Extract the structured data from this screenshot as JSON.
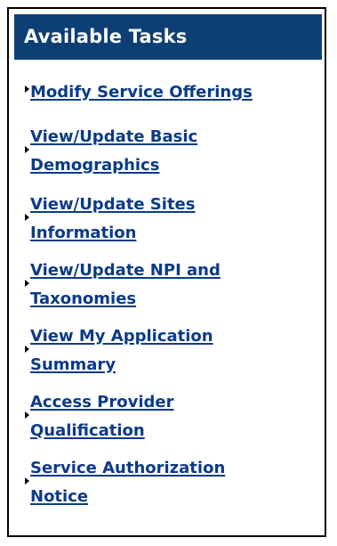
{
  "panel": {
    "title": "Available Tasks",
    "items": [
      {
        "lines": [
          "Modify Service Offerings"
        ]
      },
      {
        "lines": [
          "View/Update Basic",
          "Demographics"
        ]
      },
      {
        "lines": [
          "View/Update Sites",
          "Information"
        ]
      },
      {
        "lines": [
          "View/Update NPI and",
          "Taxonomies"
        ]
      },
      {
        "lines": [
          "View My Application",
          "Summary"
        ]
      },
      {
        "lines": [
          "Access Provider",
          "Qualification"
        ]
      },
      {
        "lines": [
          "Service Authorization",
          "Notice"
        ]
      }
    ]
  },
  "colors": {
    "header_bg": "#0d3f75",
    "link": "#0b3b86",
    "border": "#000000"
  }
}
